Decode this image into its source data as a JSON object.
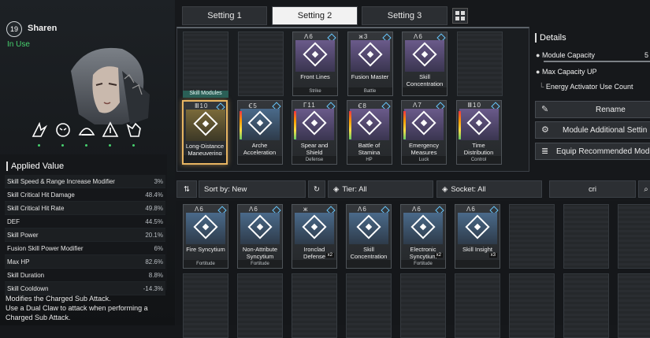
{
  "character": {
    "level": "19",
    "name": "Sharen",
    "status": "In Use"
  },
  "tabs": [
    {
      "label": "Setting 1",
      "active": false
    },
    {
      "label": "Setting 2",
      "active": true
    },
    {
      "label": "Setting 3",
      "active": false
    }
  ],
  "applied": {
    "title": "Applied Value",
    "stats": [
      {
        "name": "Skill Speed & Range Increase Modifier",
        "value": "3%"
      },
      {
        "name": "Skill Critical Hit Damage",
        "value": "48.4%"
      },
      {
        "name": "Skill Critical Hit Rate",
        "value": "49.8%"
      },
      {
        "name": "DEF",
        "value": "44.5%"
      },
      {
        "name": "Skill Power",
        "value": "20.1%"
      },
      {
        "name": "Fusion Skill Power Modifier",
        "value": "6%"
      },
      {
        "name": "Max HP",
        "value": "82.6%"
      },
      {
        "name": "Skill Duration",
        "value": "8.8%"
      },
      {
        "name": "Skill Cooldown",
        "value": "-14.3%"
      }
    ]
  },
  "description": "Modifies the Charged Sub Attack.\nUse a Dual Claw to attack when performing a Charged Sub Attack.",
  "equipped": {
    "skill_modules_label": "Skill Modules",
    "row1": [
      {
        "name": "",
        "sub": "",
        "empty": true
      },
      {
        "name": "",
        "sub": "",
        "empty": true
      },
      {
        "name": "Front Lines",
        "sub": "Strike",
        "cost": "Λ6"
      },
      {
        "name": "Fusion Master",
        "sub": "Battle",
        "cost": "ж3"
      },
      {
        "name": "Skill Concentration",
        "sub": "",
        "cost": "Λ6"
      },
      {
        "name": "",
        "sub": "",
        "empty": true
      }
    ],
    "row2": [
      {
        "name": "Long-Distance Maneuvering",
        "sub": "",
        "cost": "Ⅲ10"
      },
      {
        "name": "Arche Acceleration",
        "sub": "",
        "cost": "Ꞓ5"
      },
      {
        "name": "Spear and Shield",
        "sub": "Defense",
        "cost": "Γ11"
      },
      {
        "name": "Battle of Stamina",
        "sub": "HP",
        "cost": "Ꞓ8"
      },
      {
        "name": "Emergency Measures",
        "sub": "Luck",
        "cost": "Λ7"
      },
      {
        "name": "Time Distribution",
        "sub": "Control",
        "cost": "Ⅲ10"
      }
    ]
  },
  "details": {
    "title": "Details",
    "module_capacity": "Module Capacity",
    "max_capacity_up": "Max Capacity UP",
    "energy_activator": "Energy Activator Use Count",
    "capacity_value": "5"
  },
  "actions": [
    {
      "label": "Rename",
      "icon": "pencil-icon"
    },
    {
      "label": "Module Additional Settin",
      "icon": "gear-icon"
    },
    {
      "label": "Equip Recommended Mod",
      "icon": "bars-icon"
    }
  ],
  "filters": {
    "sort": "Sort by: New",
    "tier": "Tier: All",
    "socket": "Socket: All",
    "search_value": "cri"
  },
  "inventory": [
    {
      "name": "Fire Syncytium",
      "sub": "Fortitude",
      "cost": "Λ6",
      "count": ""
    },
    {
      "name": "Non-Attribute Syncytium",
      "sub": "Fortitude",
      "cost": "Λ6",
      "count": ""
    },
    {
      "name": "Ironclad Defense",
      "sub": "",
      "cost": "ж",
      "count": "x2"
    },
    {
      "name": "Skill Concentration",
      "sub": "",
      "cost": "Λ6",
      "count": ""
    },
    {
      "name": "Electronic Syncytium",
      "sub": "Fortitude",
      "cost": "Λ6",
      "count": "x2"
    },
    {
      "name": "Skill Insight",
      "sub": "",
      "cost": "Λ6",
      "count": "x3"
    }
  ],
  "colors": {
    "accent_green": "#47d16e",
    "selected_gold": "#e8b562",
    "socket_blue": "#68c8ff"
  }
}
